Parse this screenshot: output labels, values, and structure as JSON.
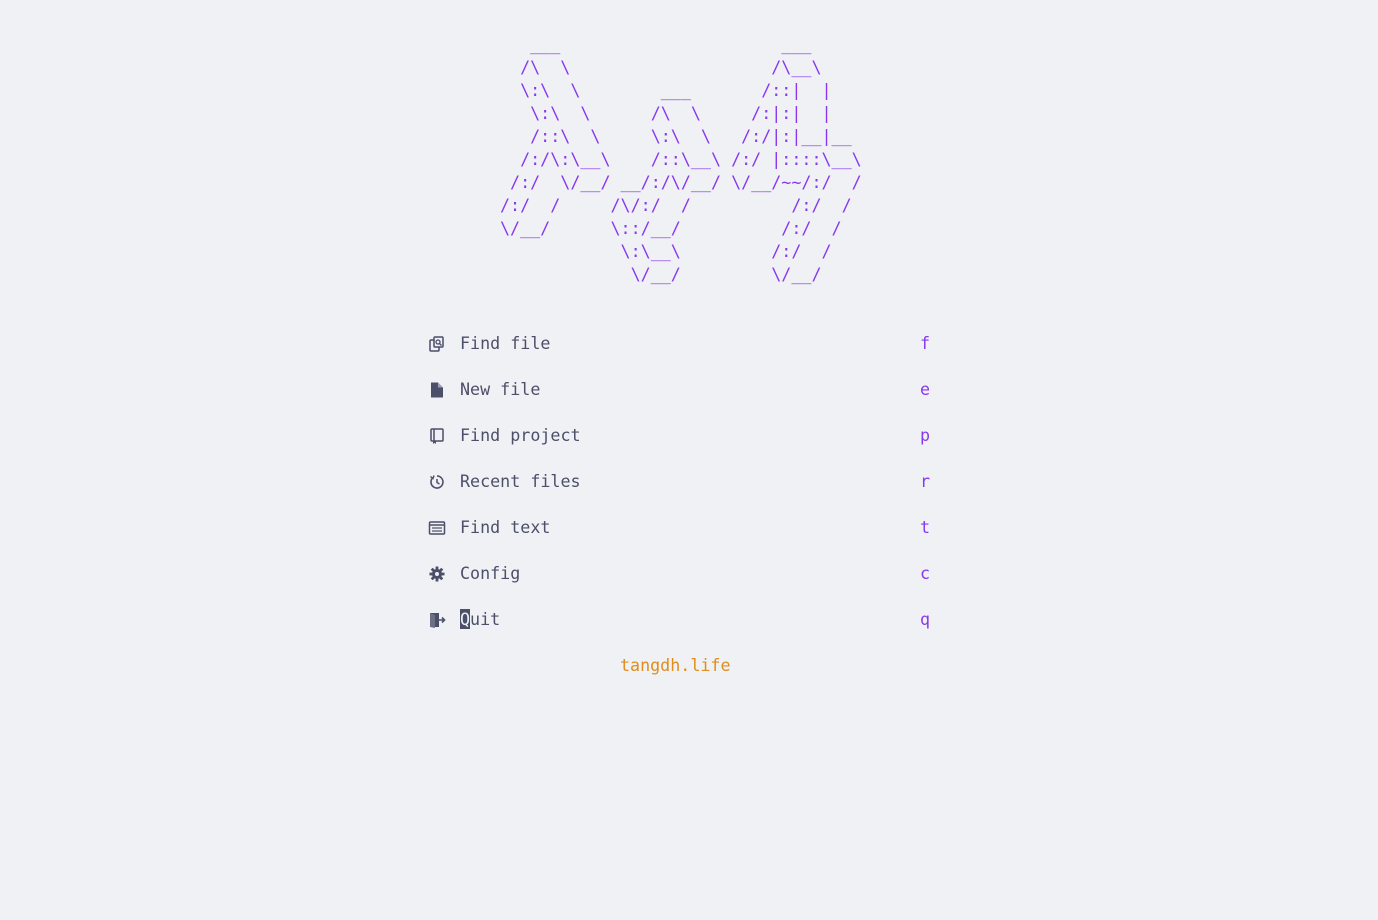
{
  "theme": {
    "background": "#eff1f5",
    "text": "#4c4f69",
    "accent": "#8839ef",
    "footer": "#df8e1d"
  },
  "header": {
    "logo_lines": [
      "   ___                      ___",
      "  /\\  \\                    /\\__\\",
      "  \\:\\  \\        ___       /::|  |",
      "   \\:\\  \\      /\\  \\     /:|:|  |",
      "   /::\\  \\     \\:\\  \\   /:/|:|__|__",
      "  /:/\\:\\__\\    /::\\__\\ /:/ |::::\\__\\",
      " /:/  \\/__/ __/:/\\/__/ \\/__/~~/:/  /",
      "/:/  /     /\\/:/  /          /:/  /",
      "\\/__/      \\::/__/          /:/  /",
      "            \\:\\__\\         /:/  /",
      "             \\/__/         \\/__/"
    ]
  },
  "menu": {
    "items": [
      {
        "icon": "find-file-icon",
        "label": "Find file",
        "key": "f"
      },
      {
        "icon": "new-file-icon",
        "label": "New file",
        "key": "e"
      },
      {
        "icon": "find-project-icon",
        "label": "Find project",
        "key": "p"
      },
      {
        "icon": "recent-files-icon",
        "label": "Recent files",
        "key": "r"
      },
      {
        "icon": "find-text-icon",
        "label": "Find text",
        "key": "t"
      },
      {
        "icon": "config-icon",
        "label": "Config",
        "key": "c"
      },
      {
        "icon": "quit-icon",
        "label": "Quit",
        "key": "q",
        "cursor_char": "Q",
        "rest": "uit"
      }
    ]
  },
  "footer": {
    "text": "tangdh.life"
  }
}
